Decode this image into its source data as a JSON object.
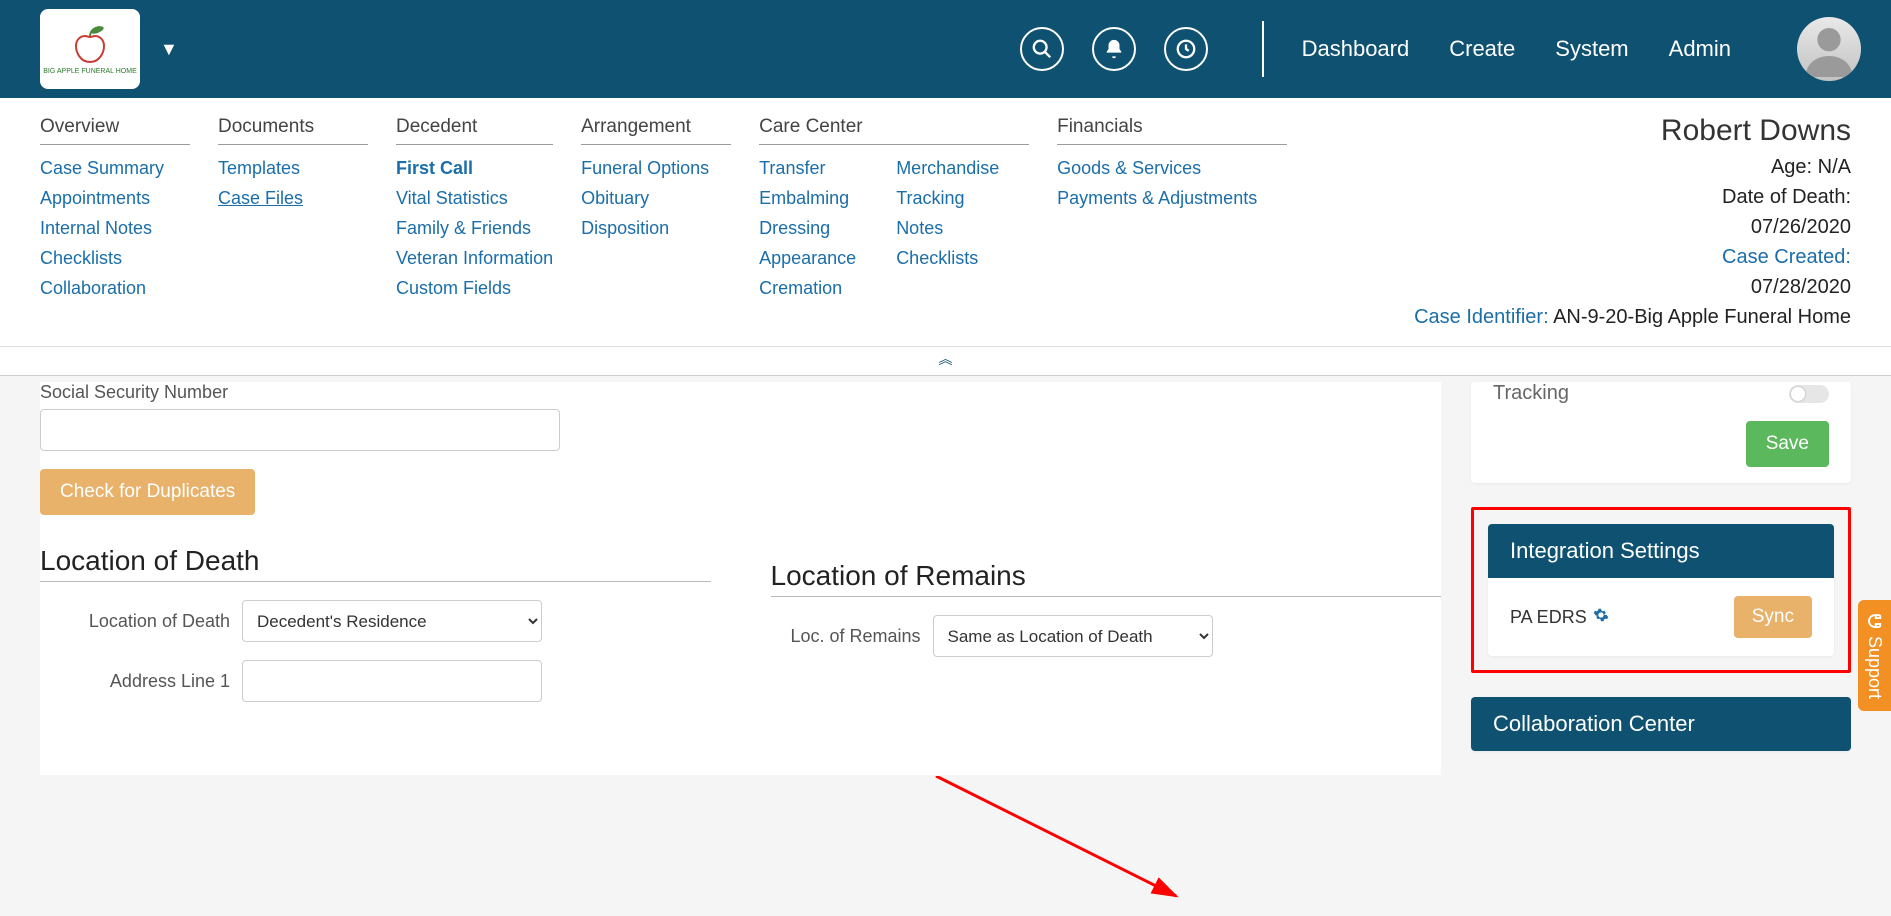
{
  "topnav": {
    "dashboard": "Dashboard",
    "create": "Create",
    "system": "System",
    "admin": "Admin"
  },
  "logo_text": "BIG APPLE FUNERAL HOME",
  "subnav": {
    "overview": {
      "heading": "Overview",
      "items": [
        "Case Summary",
        "Appointments",
        "Internal Notes",
        "Checklists",
        "Collaboration"
      ]
    },
    "documents": {
      "heading": "Documents",
      "items": [
        "Templates",
        "Case Files"
      ]
    },
    "decedent": {
      "heading": "Decedent",
      "items": [
        "First Call",
        "Vital Statistics",
        "Family & Friends",
        "Veteran Information",
        "Custom Fields"
      ]
    },
    "arrangement": {
      "heading": "Arrangement",
      "items": [
        "Funeral Options",
        "Obituary",
        "Disposition"
      ]
    },
    "carecenter": {
      "heading": "Care Center",
      "itemsA": [
        "Transfer",
        "Embalming",
        "Dressing",
        "Appearance",
        "Cremation"
      ],
      "itemsB": [
        "Merchandise",
        "Tracking",
        "Notes",
        "Checklists"
      ]
    },
    "financials": {
      "heading": "Financials",
      "items": [
        "Goods & Services",
        "Payments & Adjustments"
      ]
    }
  },
  "case": {
    "name": "Robert Downs",
    "age_label": "Age: ",
    "age_value": "N/A",
    "dod_label": "Date of Death:",
    "dod_value": "07/26/2020",
    "created_label": "Case Created:",
    "created_value": "07/28/2020",
    "id_label": "Case Identifier:",
    "id_value": " AN-9-20-Big Apple Funeral Home"
  },
  "form": {
    "ssn_label": "Social Security Number",
    "check_dup": "Check for Duplicates",
    "lod_heading": "Location of Death",
    "lor_heading": "Location of Remains",
    "lod_label": "Location of Death",
    "lod_value": "Decedent's Residence",
    "addr1_label": "Address Line 1",
    "lor_label": "Loc. of Remains",
    "lor_value": "Same as Location of Death"
  },
  "right": {
    "tracking": "Tracking",
    "save": "Save",
    "integration_heading": "Integration Settings",
    "integration_name": "PA EDRS",
    "sync": "Sync",
    "collab_heading": "Collaboration Center"
  },
  "support": "Support"
}
